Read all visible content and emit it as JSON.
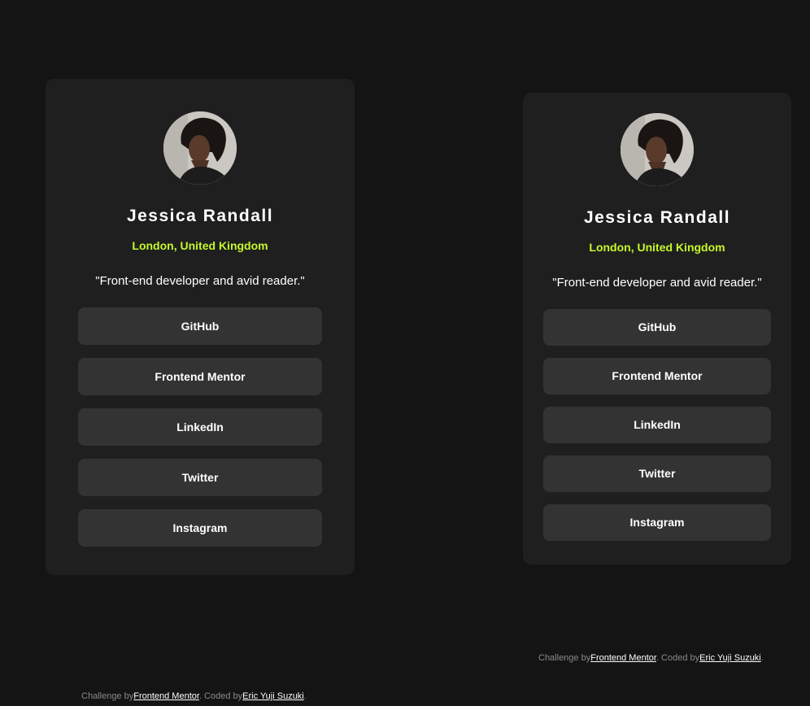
{
  "profile": {
    "name": "Jessica Randall",
    "location": "London, United Kingdom",
    "bio": "\"Front-end developer and avid reader.\""
  },
  "links": [
    {
      "label": "GitHub"
    },
    {
      "label": "Frontend Mentor"
    },
    {
      "label": "LinkedIn"
    },
    {
      "label": "Twitter"
    },
    {
      "label": "Instagram"
    }
  ],
  "attribution": {
    "challenge_prefix": "Challenge by",
    "challenge_link": "Frontend Mentor",
    "coded_prefix": ". Coded by",
    "coded_link": "Eric Yuji Suzuki",
    "suffix": "."
  },
  "colors": {
    "background": "#141414",
    "card": "#1f1f1f",
    "button": "#333333",
    "accent": "#c4f82a",
    "text": "#ffffff"
  },
  "icons": {
    "avatar": "profile-photo"
  }
}
